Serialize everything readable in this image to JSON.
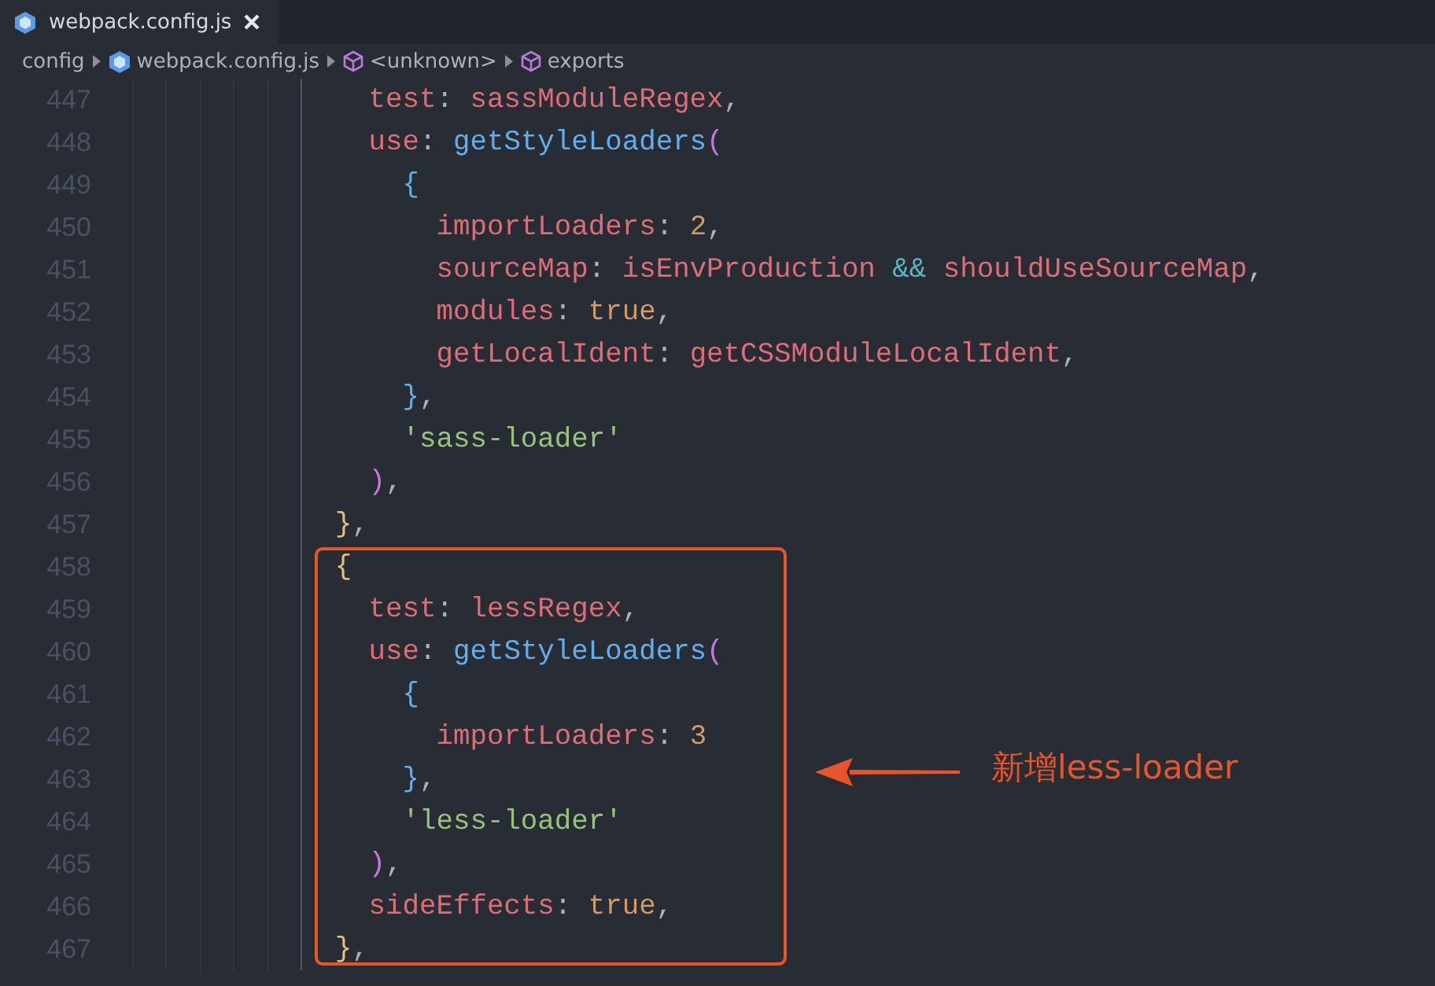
{
  "tabs": [
    {
      "label": "webpack.config.js",
      "selected": true
    }
  ],
  "breadcrumb": [
    {
      "kind": "folder",
      "label": "config"
    },
    {
      "kind": "file",
      "label": "webpack.config.js"
    },
    {
      "kind": "symbol",
      "label": "<unknown>"
    },
    {
      "kind": "symbol",
      "label": "exports"
    }
  ],
  "lines": [
    {
      "children": [
        {
          "number": "447",
          "tokens": [
            {
              "kind": "prop",
              "text": "test"
            },
            {
              "kind": "punct",
              "text": ": "
            },
            {
              "kind": "prop",
              "text": "sassModuleRegex"
            },
            {
              "kind": "punct",
              "text": ","
            }
          ]
        },
        {
          "number": "448",
          "tokens": [
            {
              "kind": "prop",
              "text": "use"
            },
            {
              "kind": "punct",
              "text": ": "
            },
            {
              "kind": "func",
              "text": "getStyleLoaders"
            },
            {
              "kind": "brace2",
              "text": "("
            }
          ],
          "children": [
            {
              "number": "449",
              "tokens": [
                {
                  "kind": "brace3",
                  "text": "{"
                }
              ],
              "children": [
                {
                  "number": "450",
                  "tokens": [
                    {
                      "kind": "prop",
                      "text": "importLoaders"
                    },
                    {
                      "kind": "punct",
                      "text": ": "
                    },
                    {
                      "kind": "num",
                      "text": "2"
                    },
                    {
                      "kind": "punct",
                      "text": ","
                    }
                  ]
                },
                {
                  "number": "451",
                  "tokens": [
                    {
                      "kind": "prop",
                      "text": "sourceMap"
                    },
                    {
                      "kind": "punct",
                      "text": ": "
                    },
                    {
                      "kind": "prop",
                      "text": "isEnvProduction"
                    },
                    {
                      "kind": "op",
                      "text": "&&"
                    },
                    {
                      "kind": "prop",
                      "text": "shouldUseSourceMap"
                    },
                    {
                      "kind": "punct",
                      "text": ","
                    }
                  ]
                },
                {
                  "number": "452",
                  "tokens": [
                    {
                      "kind": "prop",
                      "text": "modules"
                    },
                    {
                      "kind": "punct",
                      "text": ": "
                    },
                    {
                      "kind": "num",
                      "text": "true"
                    },
                    {
                      "kind": "punct",
                      "text": ","
                    }
                  ]
                },
                {
                  "number": "453",
                  "tokens": [
                    {
                      "kind": "prop",
                      "text": "getLocalIdent"
                    },
                    {
                      "kind": "punct",
                      "text": ": "
                    },
                    {
                      "kind": "prop",
                      "text": "getCSSModuleLocalIdent"
                    },
                    {
                      "kind": "punct",
                      "text": ","
                    }
                  ]
                }
              ]
            },
            {
              "number": "454",
              "tokens": [
                {
                  "kind": "brace3",
                  "text": "}"
                },
                {
                  "kind": "punct",
                  "text": ","
                }
              ]
            },
            {
              "number": "455",
              "tokens": [
                {
                  "kind": "str",
                  "text": "'sass-loader'"
                }
              ]
            }
          ]
        },
        {
          "number": "456",
          "tokens": [
            {
              "kind": "brace2",
              "text": ")"
            },
            {
              "kind": "punct",
              "text": ","
            }
          ]
        }
      ]
    },
    {
      "number": "457",
      "tokens": [
        {
          "kind": "brace1",
          "text": "}"
        },
        {
          "kind": "punct",
          "text": ","
        }
      ]
    },
    {
      "number": "458",
      "tokens": [
        {
          "kind": "brace1",
          "text": "{"
        }
      ],
      "children": [
        {
          "number": "459",
          "tokens": [
            {
              "kind": "prop",
              "text": "test"
            },
            {
              "kind": "punct",
              "text": ": "
            },
            {
              "kind": "prop",
              "text": "lessRegex"
            },
            {
              "kind": "punct",
              "text": ","
            }
          ]
        },
        {
          "number": "460",
          "tokens": [
            {
              "kind": "prop",
              "text": "use"
            },
            {
              "kind": "punct",
              "text": ": "
            },
            {
              "kind": "func",
              "text": "getStyleLoaders"
            },
            {
              "kind": "brace2",
              "text": "("
            }
          ],
          "children": [
            {
              "number": "461",
              "tokens": [
                {
                  "kind": "brace3",
                  "text": "{"
                }
              ],
              "children": [
                {
                  "number": "462",
                  "tokens": [
                    {
                      "kind": "prop",
                      "text": "importLoaders"
                    },
                    {
                      "kind": "punct",
                      "text": ": "
                    },
                    {
                      "kind": "num",
                      "text": "3"
                    }
                  ]
                }
              ]
            },
            {
              "number": "463",
              "tokens": [
                {
                  "kind": "brace3",
                  "text": "}"
                },
                {
                  "kind": "punct",
                  "text": ","
                }
              ]
            },
            {
              "number": "464",
              "tokens": [
                {
                  "kind": "str",
                  "text": "'less-loader'"
                }
              ]
            }
          ]
        },
        {
          "number": "465",
          "tokens": [
            {
              "kind": "brace2",
              "text": ")"
            },
            {
              "kind": "punct",
              "text": ","
            }
          ]
        },
        {
          "number": "466",
          "tokens": [
            {
              "kind": "prop",
              "text": "sideEffects"
            },
            {
              "kind": "punct",
              "text": ": "
            },
            {
              "kind": "num",
              "text": "true"
            },
            {
              "kind": "punct",
              "text": ","
            }
          ]
        }
      ]
    },
    {
      "number": "467",
      "tokens": [
        {
          "kind": "brace1",
          "text": "}"
        },
        {
          "kind": "punct",
          "text": ","
        }
      ]
    }
  ],
  "annotation": {
    "label": "新增less-loader"
  }
}
